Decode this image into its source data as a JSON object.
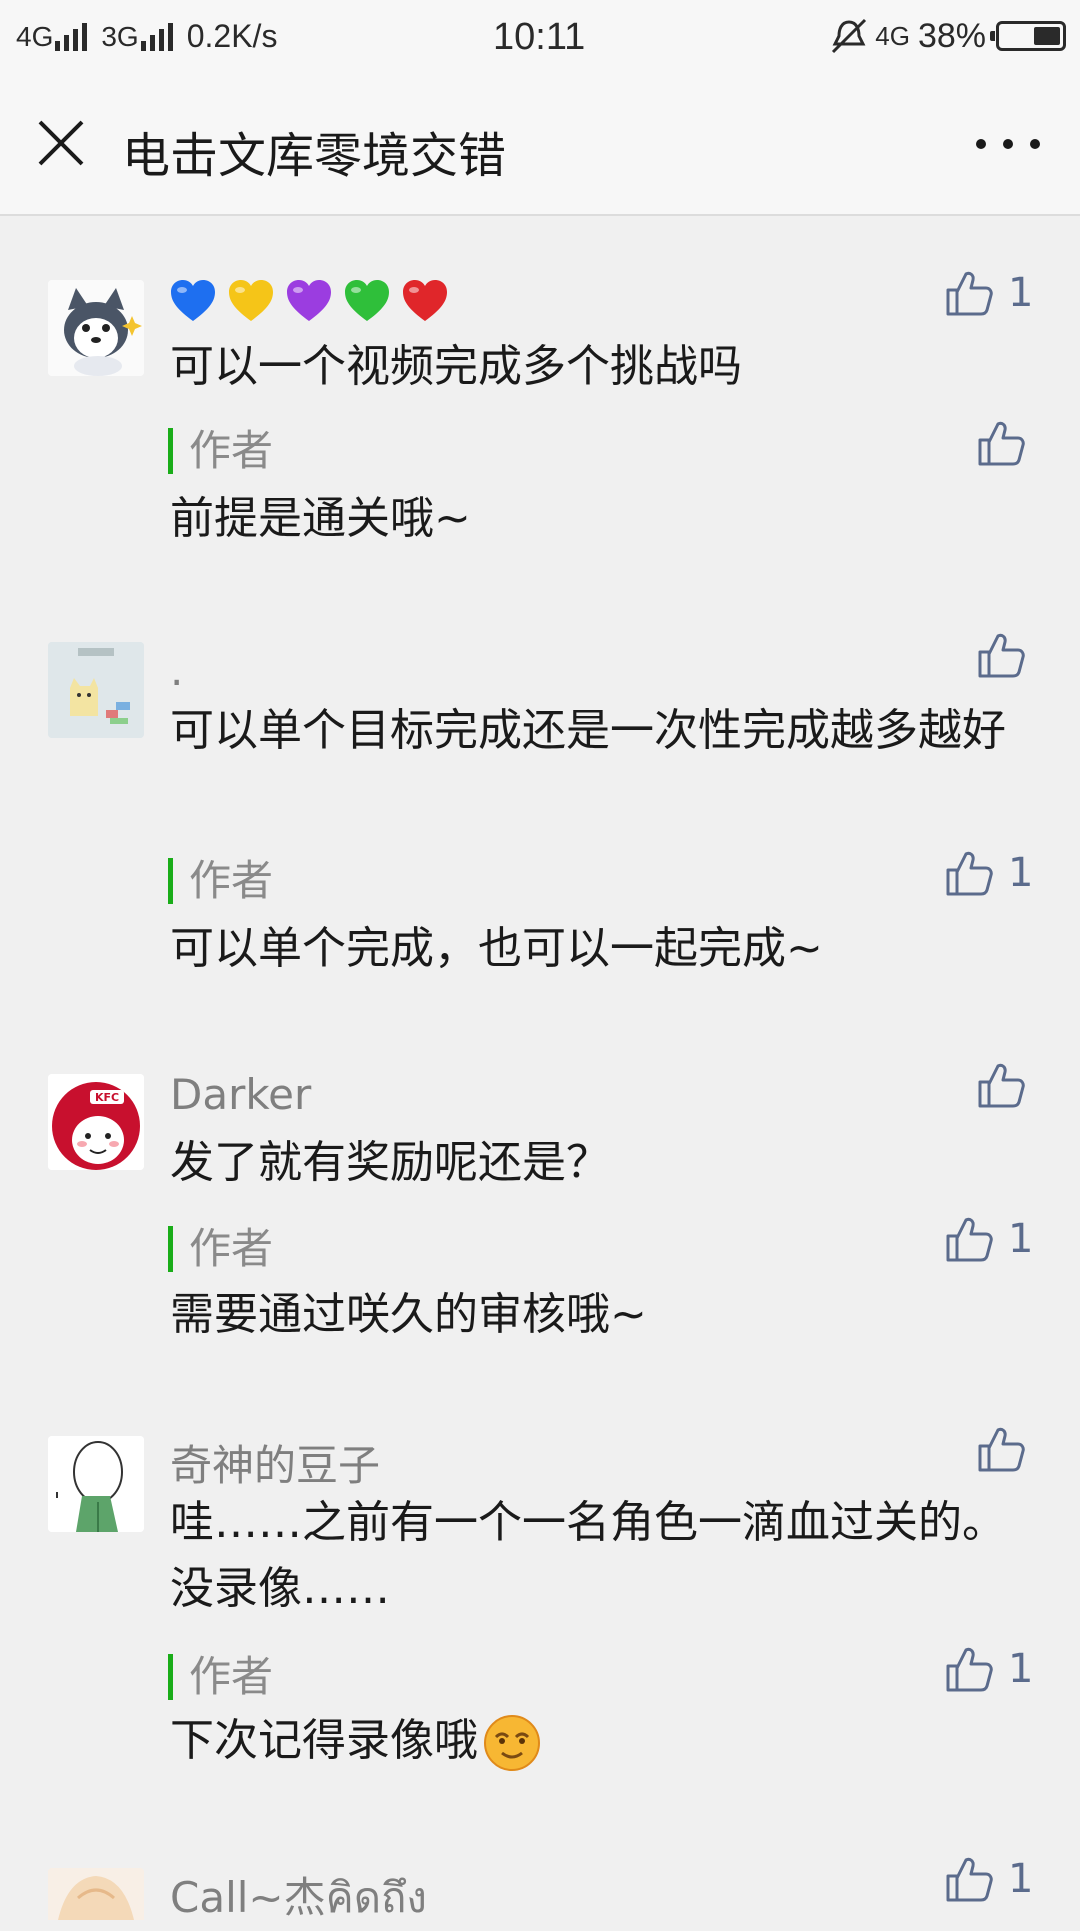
{
  "status_bar": {
    "net1": "4G",
    "net2": "3G",
    "speed": "0.2K/s",
    "time": "10:11",
    "net3": "4G",
    "battery": "38%"
  },
  "header": {
    "title": "电击文库零境交错"
  },
  "comments": [
    {
      "nick": "",
      "hearts": [
        "#1e6ff0",
        "#f5c518",
        "#9b3de0",
        "#2fbf3a",
        "#e0262a"
      ],
      "text": "可以一个视频完成多个挑战吗",
      "likes": "1",
      "reply": {
        "label": "作者",
        "text": "前提是通关哦~",
        "likes": ""
      }
    },
    {
      "nick": ".",
      "text": "可以单个目标完成还是一次性完成越多越好",
      "likes": "",
      "reply": {
        "label": "作者",
        "text": "可以单个完成，也可以一起完成~",
        "likes": "1"
      }
    },
    {
      "nick": "Darker",
      "text": "发了就有奖励呢还是？",
      "likes": "",
      "reply": {
        "label": "作者",
        "text": "需要通过咲久的审核哦~",
        "likes": "1"
      }
    },
    {
      "nick": "奇神的豆子",
      "text": "哇……之前有一个一名角色一滴血过关的。没录像……",
      "likes": "",
      "reply": {
        "label": "作者",
        "text": "下次记得录像哦",
        "likes": "1"
      }
    },
    {
      "nick": "Call~杰คิดถึง",
      "likes": "1"
    }
  ],
  "icons": {
    "close": "close-icon",
    "more": "more-icon",
    "like": "thumbs-up-icon"
  },
  "colors": {
    "author_bar": "#1aad19",
    "like": "#5b6b8c"
  }
}
